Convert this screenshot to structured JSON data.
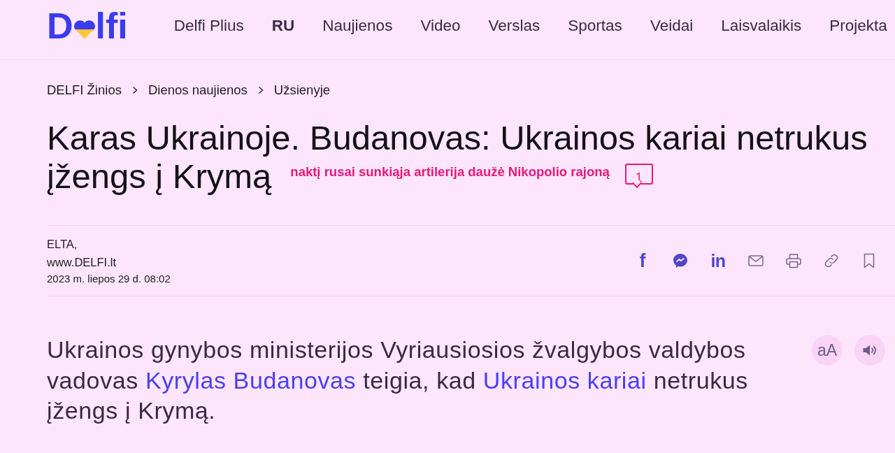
{
  "logo": {
    "lead": "D",
    "tail": "lfi"
  },
  "nav": [
    {
      "label": "Delfi Plius",
      "kind": "section"
    },
    {
      "label": "RU",
      "kind": "language"
    },
    {
      "label": "Naujienos",
      "kind": "section"
    },
    {
      "label": "Video",
      "kind": "section"
    },
    {
      "label": "Verslas",
      "kind": "section"
    },
    {
      "label": "Sportas",
      "kind": "section"
    },
    {
      "label": "Veidai",
      "kind": "section"
    },
    {
      "label": "Laisvalaikis",
      "kind": "section"
    },
    {
      "label": "Projekta",
      "kind": "section"
    }
  ],
  "breadcrumbs": [
    {
      "label": "DELFI Žinios"
    },
    {
      "label": "Dienos naujienos"
    },
    {
      "label": "Užsienyje"
    }
  ],
  "article": {
    "title": "Karas Ukrainoje. Budanovas: Ukrainos kariai netrukus įžengs į Krymą",
    "live_note": "naktį rusai sunkiąja artilerija daužė Nikopolio rajoną",
    "comment_count": "1"
  },
  "byline": {
    "source": [
      "ELTA,",
      "www.DELFI.lt"
    ],
    "date": "2023 m. liepos 29 d. 08:02"
  },
  "share": [
    {
      "kind": "facebook",
      "glyph": "f"
    },
    {
      "kind": "messenger"
    },
    {
      "kind": "linkedin",
      "glyph": "in"
    },
    {
      "kind": "email"
    },
    {
      "kind": "print"
    },
    {
      "kind": "link"
    },
    {
      "kind": "bookmark"
    }
  ],
  "reading_tools": [
    {
      "kind": "font_size",
      "label": "aA"
    },
    {
      "kind": "listen"
    }
  ],
  "lead": [
    {
      "kind": "text",
      "text": "Ukrainos gynybos ministerijos Vyriausiosios žvalgybos valdybos vadovas "
    },
    {
      "kind": "link",
      "text": "Kyrylas Budanovas"
    },
    {
      "kind": "text",
      "text": " teigia, kad "
    },
    {
      "kind": "link",
      "text": "Ukrainos kariai"
    },
    {
      "kind": "text",
      "text": " netrukus įžengs į Krymą."
    }
  ]
}
